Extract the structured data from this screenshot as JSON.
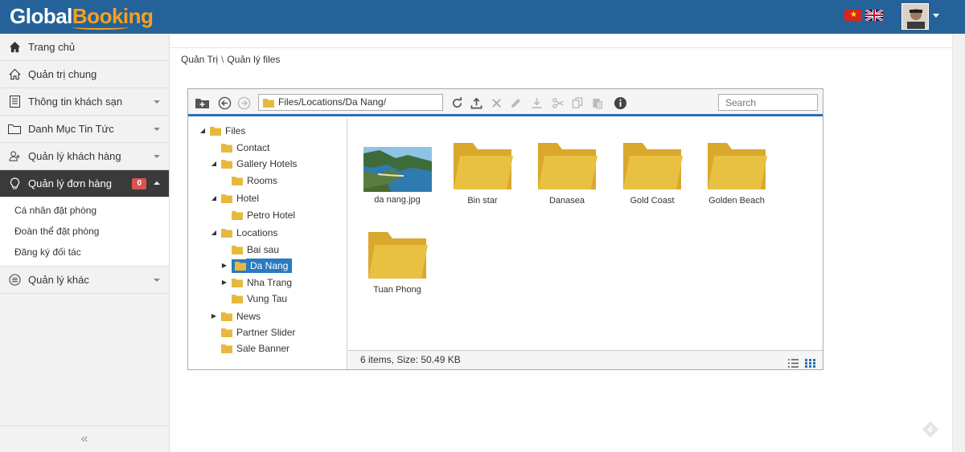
{
  "header": {
    "logo_part1": "Global",
    "logo_part2": "Booking",
    "flags": [
      "vn-flag-icon",
      "uk-flag-icon"
    ],
    "colors": {
      "bar": "#25629a",
      "accent": "#f7a01e"
    }
  },
  "sidebar": {
    "items": [
      {
        "label": "Trang chủ",
        "icon": "home-icon"
      },
      {
        "label": "Quản trị chung",
        "icon": "home-outline-icon"
      },
      {
        "label": "Thông tin khách sạn",
        "icon": "document-icon"
      },
      {
        "label": "Danh Mục Tin Tức",
        "icon": "folder-icon"
      },
      {
        "label": "Quản lý khách hàng",
        "icon": "user-icon"
      },
      {
        "label": "Quản lý đơn hàng",
        "icon": "lightbulb-icon",
        "badge": "0"
      },
      {
        "label": "Quản lý khác",
        "icon": "list-circle-icon"
      }
    ],
    "subitems": [
      "Cá nhân đặt phòng",
      "Đoàn thể đặt phòng",
      "Đăng ký đối tác"
    ],
    "collapse_label": "«"
  },
  "breadcrumb": {
    "items": [
      "Quản Trị",
      "Quản lý files"
    ],
    "separator": "\\"
  },
  "explorer": {
    "path": "Files/Locations/Da Nang/",
    "search_placeholder": "Search",
    "tree": [
      {
        "label": "Files",
        "expanded": true
      },
      {
        "label": "Contact"
      },
      {
        "label": "Gallery Hotels",
        "expanded": true
      },
      {
        "label": "Rooms"
      },
      {
        "label": "Hotel",
        "expanded": true
      },
      {
        "label": "Petro Hotel"
      },
      {
        "label": "Locations",
        "expanded": true
      },
      {
        "label": "Bai sau"
      },
      {
        "label": "Da Nang",
        "selected": true
      },
      {
        "label": "Nha Trang"
      },
      {
        "label": "Vung Tau"
      },
      {
        "label": "News"
      },
      {
        "label": "Partner Slider"
      },
      {
        "label": "Sale Banner"
      }
    ],
    "items": [
      {
        "name": "da nang.jpg",
        "type": "image"
      },
      {
        "name": "Bin star",
        "type": "folder"
      },
      {
        "name": "Danasea",
        "type": "folder"
      },
      {
        "name": "Gold Coast",
        "type": "folder"
      },
      {
        "name": "Golden Beach",
        "type": "folder"
      },
      {
        "name": "Tuan Phong",
        "type": "folder"
      }
    ],
    "status": "6 items, Size: 50.49 KB"
  }
}
